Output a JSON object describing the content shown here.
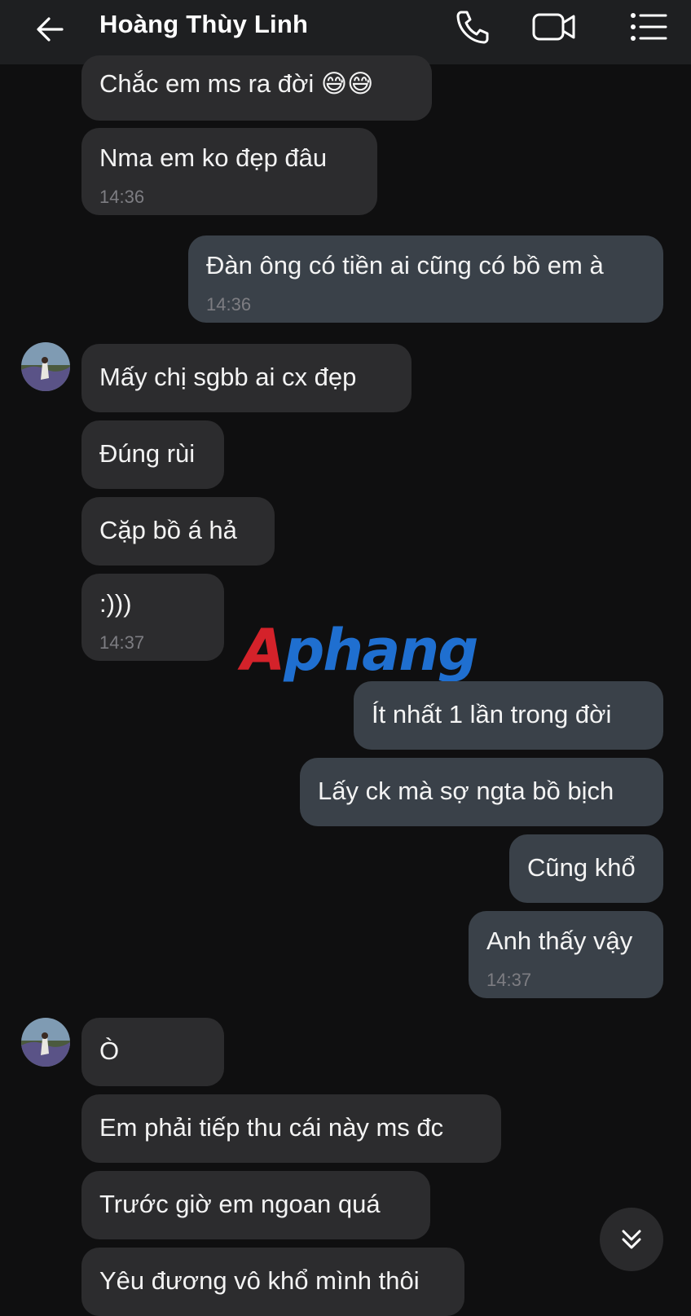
{
  "header": {
    "contact_name": "Hoàng Thùy Linh",
    "icons": [
      "back-arrow-icon",
      "phone-icon",
      "video-camera-icon",
      "menu-list-icon"
    ]
  },
  "messages": [
    {
      "side": "in",
      "text": "Chắc em ms ra đời 😅😅",
      "time": ""
    },
    {
      "side": "in",
      "text": "Nma em ko đẹp đâu",
      "time": "14:36"
    },
    {
      "side": "out",
      "text": "Đàn ông có tiền ai cũng có bồ em à",
      "time": "14:36"
    },
    {
      "side": "in",
      "text": "Mấy chị sgbb ai cx đẹp",
      "time": ""
    },
    {
      "side": "in",
      "text": "Đúng rùi",
      "time": ""
    },
    {
      "side": "in",
      "text": "Cặp bồ á hả",
      "time": ""
    },
    {
      "side": "in",
      "text": ":)))",
      "time": "14:37"
    },
    {
      "side": "out",
      "text": "Ít nhất 1 lần trong đời",
      "time": ""
    },
    {
      "side": "out",
      "text": "Lấy ck mà sợ ngta bồ bịch",
      "time": ""
    },
    {
      "side": "out",
      "text": "Cũng khổ",
      "time": ""
    },
    {
      "side": "out",
      "text": "Anh thấy vậy",
      "time": "14:37"
    },
    {
      "side": "in",
      "text": "Ò",
      "time": ""
    },
    {
      "side": "in",
      "text": "Em phải tiếp thu cái này ms đc",
      "time": ""
    },
    {
      "side": "in",
      "text": "Trước giờ em ngoan quá",
      "time": ""
    },
    {
      "side": "in",
      "text": "Yêu đương vô khổ mình thôi",
      "time": ""
    }
  ],
  "watermark": {
    "part1": "A",
    "part2": "phang"
  },
  "colors": {
    "background": "#0f0f10",
    "header": "#1e1f21",
    "incoming_bubble": "#2c2c2e",
    "outgoing_bubble": "#3a4149",
    "timestamp": "#7d7d82"
  }
}
